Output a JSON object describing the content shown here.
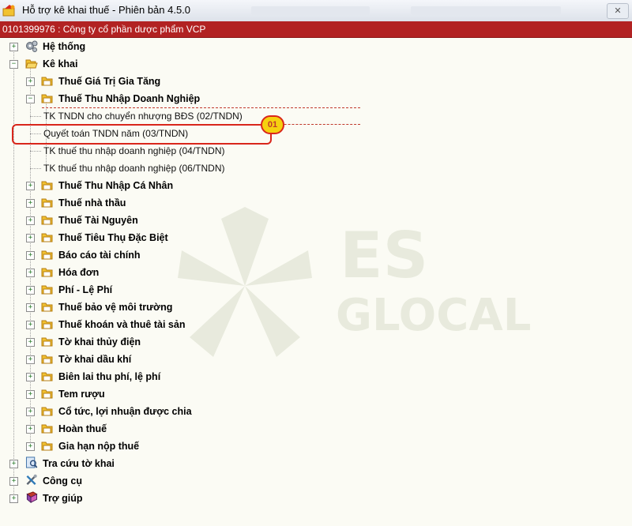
{
  "window": {
    "title": "Hỗ trợ kê khai thuế -  Phiên bản 4.5.0"
  },
  "company": {
    "label": "0101399976 : Công ty cổ phần dược phẩm VCP"
  },
  "tree": {
    "he_thong": "Hệ thống",
    "ke_khai": "Kê khai",
    "gtgt": "Thuế Giá Trị Gia Tăng",
    "tndn": "Thuế Thu Nhập Doanh Nghiệp",
    "tndn_items": [
      "TK TNDN cho chuyển nhượng BĐS (02/TNDN)",
      "Quyết toán TNDN năm (03/TNDN)",
      "TK thuế thu nhập doanh nghiệp (04/TNDN)",
      "TK thuế thu nhập doanh nghiệp (06/TNDN)"
    ],
    "ke_khai_items": [
      "Thuế Thu Nhập Cá Nhân",
      "Thuế nhà thầu",
      "Thuế Tài Nguyên",
      "Thuế Tiêu Thụ Đặc Biệt",
      "Báo cáo tài chính",
      "Hóa đơn",
      "Phí - Lệ Phí",
      "Thuế bảo vệ môi trường",
      "Thuế khoán và thuê tài sản",
      "Tờ khai thủy điện",
      "Tờ khai dầu khí",
      "Biên lai thu phí, lệ phí",
      "Tem rượu",
      "Cổ tức, lợi nhuận được chia",
      "Hoàn thuế",
      "Gia hạn nộp thuế"
    ],
    "tra_cuu": "Tra cứu tờ khai",
    "cong_cu": "Công cụ",
    "tro_giup": "Trợ giúp"
  },
  "annotation": {
    "step": "01"
  },
  "colors": {
    "header_red": "#b22222",
    "highlight_red": "#d9261c",
    "badge_yellow": "#f6d10f",
    "folder_yellow": "#f2c230"
  },
  "icons": {
    "he_thong": "gears-icon",
    "ke_khai": "folder-icon",
    "tra_cuu": "search-document-icon",
    "cong_cu": "tools-icon",
    "tro_giup": "help-book-icon"
  }
}
